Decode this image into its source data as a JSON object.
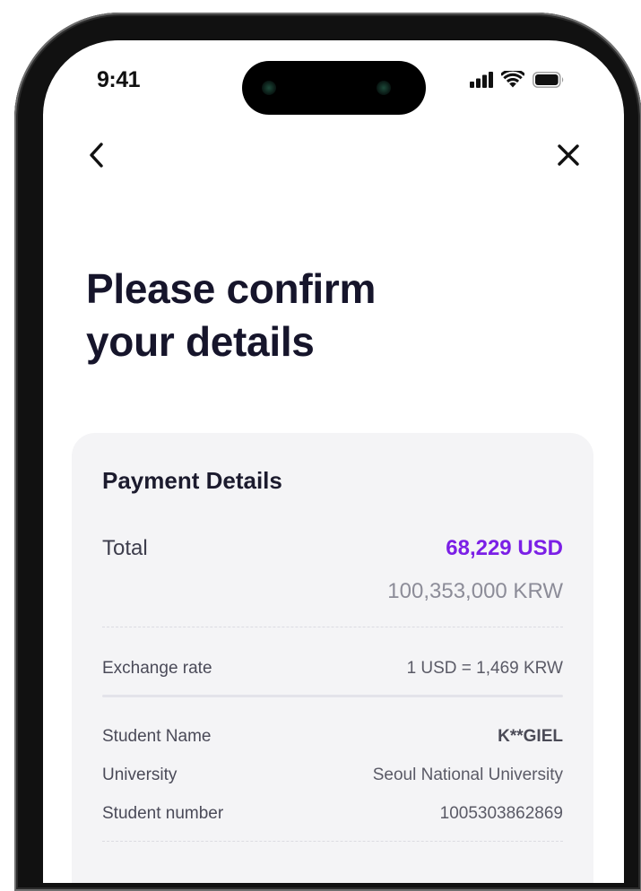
{
  "status_bar": {
    "time": "9:41"
  },
  "nav": {
    "back_icon": "chevron-left-icon",
    "close_icon": "close-icon"
  },
  "title": {
    "line1": "Please confirm",
    "line2": "your details"
  },
  "payment_details": {
    "heading": "Payment Details",
    "total_label": "Total",
    "total_usd": "68,229 USD",
    "total_krw": "100,353,000 KRW",
    "exchange_rate_label": "Exchange rate",
    "exchange_rate_value": "1 USD = 1,469 KRW",
    "student_name_label": "Student Name",
    "student_name_value": "K**GIEL",
    "university_label": "University",
    "university_value": "Seoul National University",
    "student_number_label": "Student number",
    "student_number_value": "1005303862869"
  },
  "colors": {
    "accent": "#7b1fe6",
    "title": "#16152b",
    "card_bg": "#f4f4f6"
  }
}
